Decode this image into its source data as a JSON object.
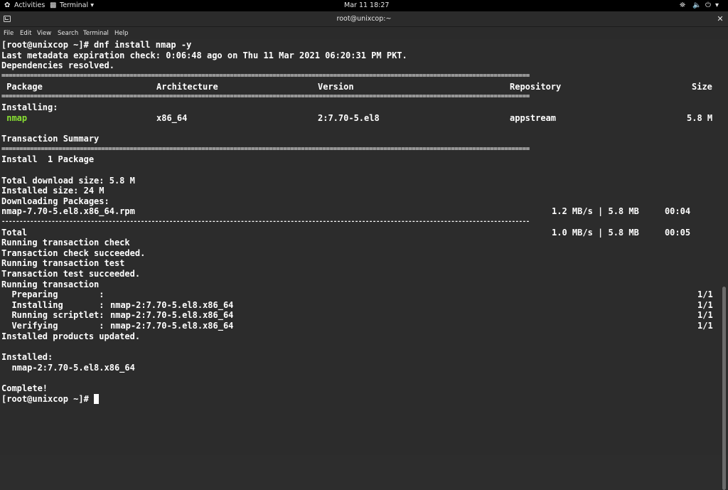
{
  "topbar": {
    "activities": "Activities",
    "app": "Terminal",
    "clock": "Mar 11  18:27"
  },
  "window": {
    "title": "root@unixcop:~"
  },
  "menu": [
    "File",
    "Edit",
    "View",
    "Search",
    "Terminal",
    "Help"
  ],
  "terminal": {
    "cmd": "[root@unixcop ~]# dnf install nmap -y",
    "meta": "Last metadata expiration check: 0:06:48 ago on Thu 11 Mar 2021 06:20:31 PM PKT.",
    "deps": "Dependencies resolved.",
    "sep_eq": "====================================================================================================================================================",
    "sep_dash": "----------------------------------------------------------------------------------------------------------------------------------------------------",
    "headers": {
      "package": " Package",
      "arch": "Architecture",
      "version": "Version",
      "repo": "Repository",
      "size": "Size"
    },
    "installing_label": "Installing:",
    "pkg": {
      "name": " nmap",
      "arch": "x86_64",
      "version": "2:7.70-5.el8",
      "repo": "appstream",
      "size": "5.8 M"
    },
    "tx_summary": "Transaction Summary",
    "install_count": "Install  1 Package",
    "total_dl": "Total download size: 5.8 M",
    "installed_size": "Installed size: 24 M",
    "downloading": "Downloading Packages:",
    "rpm_file": "nmap-7.70-5.el8.x86_64.rpm",
    "rpm_stats": "1.2 MB/s | 5.8 MB     00:04",
    "total_label": "Total",
    "total_stats": "1.0 MB/s | 5.8 MB     00:05",
    "running_check": "Running transaction check",
    "check_ok": "Transaction check succeeded.",
    "running_test": "Running transaction test",
    "test_ok": "Transaction test succeeded.",
    "running_tx": "Running transaction",
    "steps": [
      {
        "label": "  Preparing        :",
        "pkg": "",
        "count": "1/1"
      },
      {
        "label": "  Installing       :",
        "pkg": "nmap-2:7.70-5.el8.x86_64",
        "count": "1/1"
      },
      {
        "label": "  Running scriptlet:",
        "pkg": "nmap-2:7.70-5.el8.x86_64",
        "count": "1/1"
      },
      {
        "label": "  Verifying        :",
        "pkg": "nmap-2:7.70-5.el8.x86_64",
        "count": "1/1"
      }
    ],
    "products_updated": "Installed products updated.",
    "installed_label": "Installed:",
    "installed_pkg": "  nmap-2:7.70-5.el8.x86_64",
    "complete": "Complete!",
    "prompt": "[root@unixcop ~]# "
  }
}
